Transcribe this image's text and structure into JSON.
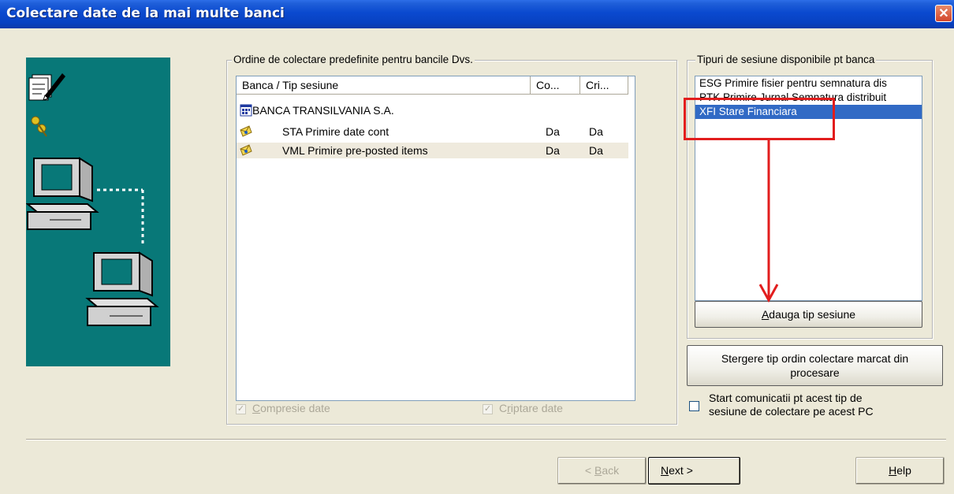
{
  "window": {
    "title": "Colectare date de la mai multe banci",
    "close_glyph": "✕"
  },
  "order_group": {
    "legend": "Ordine de colectare predefinite pentru bancile Dvs.",
    "columns": [
      "Banca / Tip sesiune",
      "Co...",
      "Cri..."
    ],
    "bank": "BANCA TRANSILVANIA S.A.",
    "rows": [
      {
        "label": "STA Primire date cont",
        "co": "Da",
        "cri": "Da"
      },
      {
        "label": "VML Primire pre-posted items",
        "co": "Da",
        "cri": "Da"
      }
    ],
    "compresie_label": "Compresie date",
    "criptare_label": "Criptare date"
  },
  "session_group": {
    "legend": "Tipuri de sesiune disponibile pt banca",
    "items": [
      "ESG Primire fisier pentru semnatura dis",
      "PTK Primire Jurnal Semnatura distribuit",
      "XFI Stare Financiara"
    ],
    "selected_index": 2,
    "add_button": "Adauga tip sesiune"
  },
  "delete_button": {
    "line1": "Stergere tip ordin colectare marcat din",
    "line2": "procesare"
  },
  "start_check": {
    "line1": "Start comunicatii pt acest tip de",
    "line2": "sesiune de colectare pe acest PC",
    "checked": false
  },
  "footer": {
    "back": "< Back",
    "next": "Next >",
    "help": "Help"
  },
  "colors": {
    "titlebar": "#0a49cf",
    "illustration_bg": "#087878",
    "selection": "#316ac5",
    "annotation": "#e21d1d"
  },
  "icons": {
    "illustration": [
      "document-pen-icon",
      "keys-icon",
      "computer-icon",
      "network-link-icon"
    ],
    "bank": "bank-icon",
    "session": "envelope-key-icon"
  }
}
